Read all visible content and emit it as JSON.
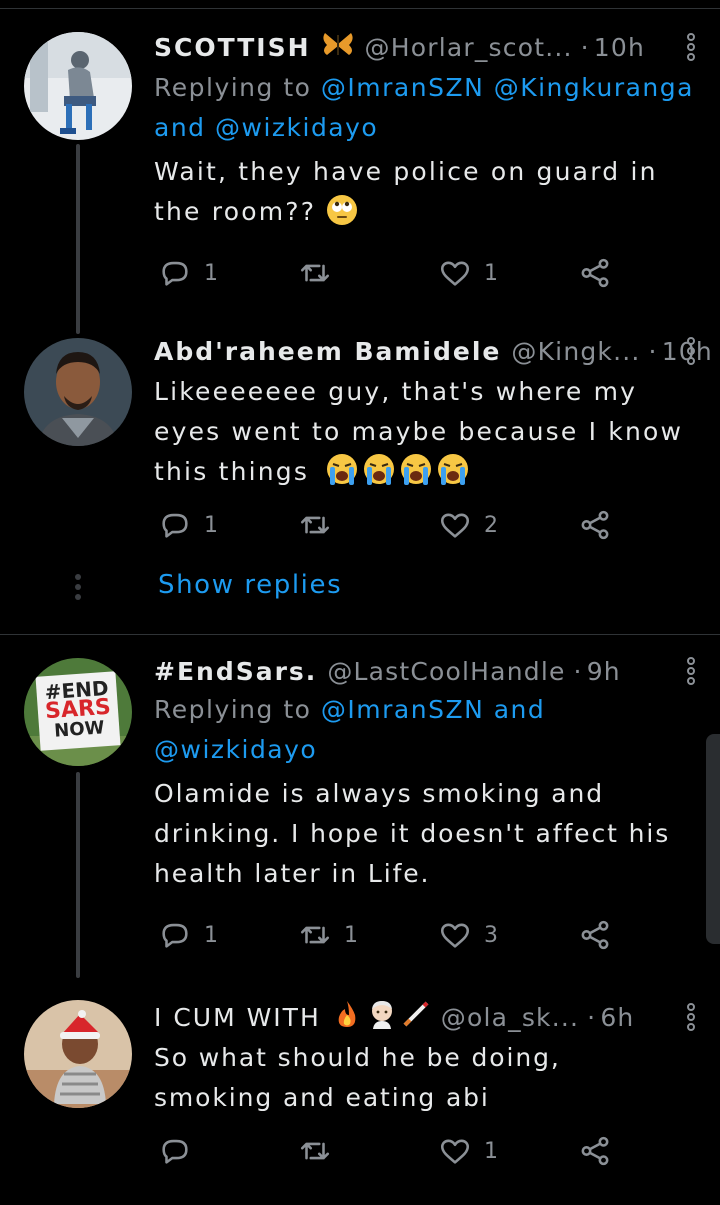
{
  "tweets": [
    {
      "name": "SCOTTISH",
      "handle": "@Horlar_scot...",
      "time": "10h",
      "reply_prefix": "Replying to",
      "mentions": "@ImranSZN @Kingkuranga",
      "mentions_and": "and",
      "mentions_2": "@wizkidayo",
      "text": "Wait, they have police on guard in the room??",
      "replies": "1",
      "retweets": "",
      "likes": "1"
    },
    {
      "name": "Abd'raheem Bamidele",
      "handle": "@Kingk...",
      "time": "10h",
      "text": "Likeeeeeee guy, that's where my eyes went to maybe because I know this things",
      "replies": "1",
      "retweets": "",
      "likes": "2"
    },
    {
      "name": "#EndSars.",
      "handle": "@LastCoolHandle",
      "time": "9h",
      "reply_prefix": "Replying to",
      "mentions": "@ImranSZN",
      "mentions_and": "and",
      "mentions_2": "@wizkidayo",
      "text": "Olamide is always smoking and drinking. I hope it doesn't affect his health later in Life.",
      "replies": "1",
      "retweets": "1",
      "likes": "3"
    },
    {
      "name": "I CUM WITH",
      "handle": "@ola_sk...",
      "time": "6h",
      "text": "So what should he be doing, smoking and eating abi",
      "replies": "",
      "retweets": "",
      "likes": "1"
    }
  ],
  "show_replies": "Show replies",
  "avatar_sign": {
    "line1": "#END",
    "line2": "SARS",
    "line3": "NOW"
  },
  "colors": {
    "background": "#000000",
    "accent": "#1d9bf0",
    "muted": "#8b9096"
  },
  "icons": [
    "reply-icon",
    "retweet-icon",
    "like-icon",
    "share-icon",
    "more-icon"
  ]
}
